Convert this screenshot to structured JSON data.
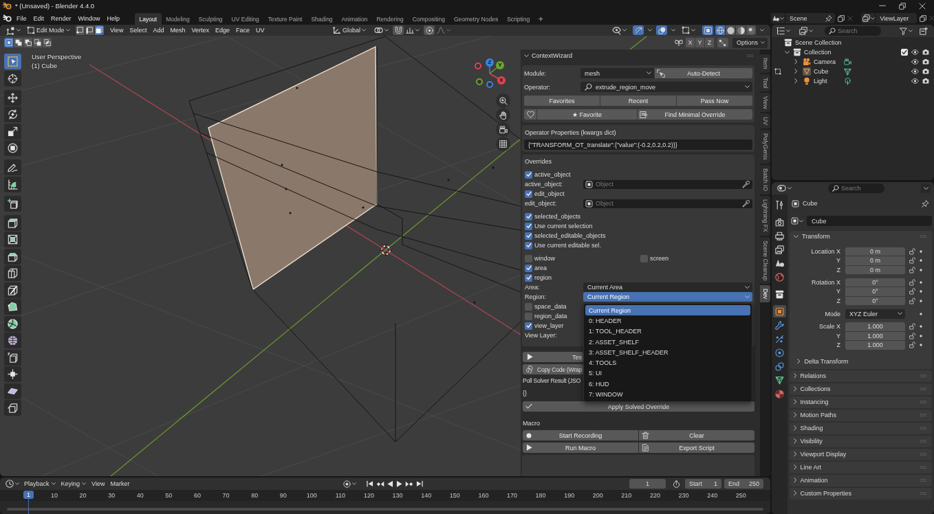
{
  "title_bar": {
    "title": "* (Unsaved) - Blender 4.4.0"
  },
  "top_bar": {
    "menus": [
      "File",
      "Edit",
      "Render",
      "Window",
      "Help"
    ],
    "workspaces": [
      {
        "label": "Layout",
        "selected": true
      },
      {
        "label": "Modeling",
        "selected": false
      },
      {
        "label": "Sculpting",
        "selected": false
      },
      {
        "label": "UV Editing",
        "selected": false
      },
      {
        "label": "Texture Paint",
        "selected": false
      },
      {
        "label": "Shading",
        "selected": false
      },
      {
        "label": "Animation",
        "selected": false
      },
      {
        "label": "Rendering",
        "selected": false
      },
      {
        "label": "Compositing",
        "selected": false
      },
      {
        "label": "Geometry Nodes",
        "selected": false
      },
      {
        "label": "Scripting",
        "selected": false
      }
    ],
    "add_workspace": "+",
    "scene": "Scene",
    "view_layer": "ViewLayer"
  },
  "viewport": {
    "header": {
      "mode": "Edit Mode",
      "select_modes": [
        {
          "kind": "vertex",
          "selected": false
        },
        {
          "kind": "edge",
          "selected": false
        },
        {
          "kind": "face",
          "selected": true
        }
      ],
      "menus": [
        "View",
        "Select",
        "Add",
        "Mesh",
        "Vertex",
        "Edge",
        "Face",
        "UV"
      ],
      "orientation": "Global",
      "snapping": {
        "on": false
      },
      "proportional_editing": {
        "on": false
      },
      "gizmos": {
        "on": true
      },
      "overlays": {
        "on": true
      },
      "xray": {
        "on": true
      },
      "shading": [
        {
          "kind": "wireframe",
          "selected": true
        },
        {
          "kind": "solid",
          "selected": false
        },
        {
          "kind": "material",
          "selected": false
        },
        {
          "kind": "rendered",
          "selected": false
        }
      ]
    },
    "tool_settings": {
      "select_box_modes": [
        {
          "kind": "set",
          "selected": true
        },
        {
          "kind": "extend",
          "selected": false
        },
        {
          "kind": "subtract",
          "selected": false
        },
        {
          "kind": "invert",
          "selected": false
        },
        {
          "kind": "intersect",
          "selected": false
        }
      ],
      "mirror_axes": [
        {
          "label": "X",
          "selected": false
        },
        {
          "label": "Y",
          "selected": false
        },
        {
          "label": "Z",
          "selected": false
        }
      ],
      "options": "Options"
    },
    "view_name": "User Perspective",
    "object_label": "(1) Cube",
    "gizmo_axes": [
      {
        "label": "Z",
        "color": "#3b82e0"
      },
      {
        "label": "Y",
        "color": "#6aa52c"
      },
      {
        "label": "X",
        "color": "#e0434f"
      }
    ],
    "tool_groups": [
      [
        {
          "kind": "select_box",
          "selected": true
        },
        {
          "kind": "cursor",
          "selected": false
        }
      ],
      [
        {
          "kind": "move",
          "selected": false
        },
        {
          "kind": "rotate",
          "selected": false
        },
        {
          "kind": "scale",
          "selected": false
        },
        {
          "kind": "transform",
          "selected": false
        }
      ],
      [
        {
          "kind": "annotate",
          "selected": false
        },
        {
          "kind": "measure",
          "selected": false
        }
      ],
      [
        {
          "kind": "add_cube",
          "selected": false
        }
      ],
      [
        {
          "kind": "extrude",
          "selected": false
        },
        {
          "kind": "inset",
          "selected": false
        },
        {
          "kind": "bevel",
          "selected": false
        },
        {
          "kind": "loop_cut",
          "selected": false
        },
        {
          "kind": "knife",
          "selected": false
        },
        {
          "kind": "poly_build",
          "selected": false
        },
        {
          "kind": "spin",
          "selected": false
        },
        {
          "kind": "smooth",
          "selected": false
        },
        {
          "kind": "edge_slide",
          "selected": false
        },
        {
          "kind": "shrink_fatten",
          "selected": false
        },
        {
          "kind": "shear",
          "selected": false
        },
        {
          "kind": "rip",
          "selected": false
        }
      ]
    ]
  },
  "sidebar": {
    "tabs": [
      {
        "label": "Item",
        "selected": false
      },
      {
        "label": "Tool",
        "selected": false
      },
      {
        "label": "View",
        "selected": false
      },
      {
        "label": "UV",
        "selected": false
      },
      {
        "label": "PolyGenix",
        "selected": false
      },
      {
        "label": "Batch IO",
        "selected": false
      },
      {
        "label": "Lightning FX",
        "selected": false
      },
      {
        "label": "Scene Cleanup",
        "selected": false
      },
      {
        "label": "Dev",
        "selected": true
      }
    ],
    "panel": {
      "title": "ContextWizard",
      "expanded": true
    },
    "module": {
      "label": "Module:",
      "value": "mesh"
    },
    "auto_detect": "Auto-Detect",
    "operator": {
      "label": "Operator:",
      "value": "extrude_region_move"
    },
    "list_buttons": [
      "Favorites",
      "Recent",
      "Pass Now"
    ],
    "favorite_button": "★ Favorite",
    "find_override_button": "Find Minimal Override",
    "operator_properties": {
      "title": "Operator Properties (kwargs dict)",
      "value": "{\"TRANSFORM_OT_translate\":{\"value\":(-0.2,0.2,0.2)}}"
    },
    "overrides": {
      "title": "Overrides",
      "groups": [
        [
          {
            "kind": "checkbox",
            "label": "active_object",
            "checked": true
          },
          {
            "kind": "object_field",
            "label": "active_object:",
            "placeholder": "Object"
          },
          {
            "kind": "checkbox",
            "label": "edit_object",
            "checked": true
          },
          {
            "kind": "object_field",
            "label": "edit_object:",
            "placeholder": "Object"
          }
        ],
        [
          {
            "kind": "checkbox",
            "label": "selected_objects",
            "checked": true
          },
          {
            "kind": "checkbox",
            "label": "Use current selection",
            "checked": true
          },
          {
            "kind": "checkbox",
            "label": "selected_editable_objects",
            "checked": true
          },
          {
            "kind": "checkbox",
            "label": "Use current editable sel.",
            "checked": true
          }
        ],
        [
          {
            "kind": "checkbox_pair",
            "items": [
              {
                "label": "window",
                "checked": false
              },
              {
                "label": "screen",
                "checked": false
              }
            ]
          },
          {
            "kind": "checkbox",
            "label": "area",
            "checked": true
          },
          {
            "kind": "checkbox",
            "label": "region",
            "checked": true
          },
          {
            "kind": "dropdown",
            "label": "Area:",
            "value": "Current Area",
            "open": false
          },
          {
            "kind": "dropdown",
            "label": "Region:",
            "value": "Current Region",
            "open": true
          },
          {
            "kind": "checkbox",
            "label": "space_data",
            "checked": false
          },
          {
            "kind": "checkbox",
            "label": "region_data",
            "checked": false
          },
          {
            "kind": "checkbox",
            "label": "view_layer",
            "checked": true
          },
          {
            "kind": "label",
            "label": "View Layer:"
          }
        ]
      ]
    },
    "test_button": "Tes",
    "copy_code_button": "Copy Code (Wrap",
    "poll_result": {
      "label": "Poll Solver Result (JSO",
      "value": "{}"
    },
    "apply_button": "Apply Solved Override",
    "macro": {
      "title": "Macro",
      "start_recording": "Start Recording",
      "clear": "Clear",
      "run_macro": "Run Macro",
      "export_script": "Export Script"
    },
    "region_menu": {
      "items": [
        {
          "label": "Current Region",
          "selected": true
        },
        {
          "label": "0: HEADER",
          "selected": false
        },
        {
          "label": "1: TOOL_HEADER",
          "selected": false
        },
        {
          "label": "2: ASSET_SHELF",
          "selected": false
        },
        {
          "label": "3: ASSET_SHELF_HEADER",
          "selected": false
        },
        {
          "label": "4: TOOLS",
          "selected": false
        },
        {
          "label": "5: UI",
          "selected": false
        },
        {
          "label": "6: HUD",
          "selected": false
        },
        {
          "label": "7: WINDOW",
          "selected": false
        }
      ]
    }
  },
  "outliner": {
    "search_placeholder": "Search",
    "tree": [
      {
        "label": "Scene Collection",
        "kind": "scene_collection",
        "children": [
          {
            "label": "Collection",
            "kind": "collection",
            "expanded": true,
            "checked": true,
            "children": [
              {
                "label": "Camera",
                "kind": "camera",
                "expanded": false,
                "active": false
              },
              {
                "label": "Cube",
                "kind": "mesh",
                "expanded": false,
                "active": true
              },
              {
                "label": "Light",
                "kind": "light",
                "expanded": false,
                "active": false
              }
            ]
          }
        ]
      }
    ]
  },
  "properties": {
    "search_placeholder": "Search",
    "tab_groups": [
      [
        {
          "kind": "tool",
          "selected": false
        }
      ],
      [
        {
          "kind": "render",
          "selected": false
        },
        {
          "kind": "output",
          "selected": false
        },
        {
          "kind": "view_layer",
          "selected": false
        },
        {
          "kind": "scene",
          "selected": false
        },
        {
          "kind": "world",
          "selected": false
        }
      ],
      [
        {
          "kind": "collection",
          "selected": false
        }
      ],
      [
        {
          "kind": "object",
          "selected": true
        },
        {
          "kind": "modifiers",
          "selected": false
        },
        {
          "kind": "particles",
          "selected": false
        },
        {
          "kind": "physics",
          "selected": false
        },
        {
          "kind": "constraints",
          "selected": false
        },
        {
          "kind": "data",
          "selected": false
        },
        {
          "kind": "material",
          "selected": false
        }
      ]
    ],
    "context": "Cube",
    "object_name": "Cube",
    "transform": {
      "title": "Transform",
      "expanded": true,
      "groups": [
        {
          "kind": "vector",
          "rows": [
            {
              "label": "Location X",
              "value": "0 m"
            },
            {
              "label": "Y",
              "value": "0 m"
            },
            {
              "label": "Z",
              "value": "0 m"
            }
          ]
        },
        {
          "kind": "vector",
          "rows": [
            {
              "label": "Rotation X",
              "value": "0°"
            },
            {
              "label": "Y",
              "value": "0°"
            },
            {
              "label": "Z",
              "value": "0°"
            }
          ]
        },
        {
          "kind": "enum",
          "label": "Mode",
          "value": "XYZ Euler"
        },
        {
          "kind": "vector",
          "rows": [
            {
              "label": "Scale X",
              "value": "1.000"
            },
            {
              "label": "Y",
              "value": "1.000"
            },
            {
              "label": "Z",
              "value": "1.000"
            }
          ]
        }
      ],
      "subpanels": [
        {
          "title": "Delta Transform",
          "expanded": false
        }
      ]
    },
    "panels": [
      {
        "title": "Relations",
        "expanded": false
      },
      {
        "title": "Collections",
        "expanded": false
      },
      {
        "title": "Instancing",
        "expanded": false
      },
      {
        "title": "Motion Paths",
        "expanded": false
      },
      {
        "title": "Shading",
        "expanded": false
      },
      {
        "title": "Visibility",
        "expanded": false
      },
      {
        "title": "Viewport Display",
        "expanded": false
      },
      {
        "title": "Line Art",
        "expanded": false
      },
      {
        "title": "Animation",
        "expanded": false
      },
      {
        "title": "Custom Properties",
        "expanded": false
      }
    ]
  },
  "timeline": {
    "menus": [
      {
        "label": "Playback",
        "dropdown": true
      },
      {
        "label": "Keying",
        "dropdown": true
      },
      {
        "label": "View",
        "dropdown": false
      },
      {
        "label": "Marker",
        "dropdown": false
      }
    ],
    "current_frame": "1",
    "start": {
      "label": "Start",
      "value": "1"
    },
    "end": {
      "label": "End",
      "value": "250"
    },
    "playhead": "1",
    "ruler_labels": [
      "10",
      "20",
      "30",
      "40",
      "50",
      "60",
      "70",
      "80",
      "90",
      "100",
      "110",
      "120",
      "130",
      "140",
      "150",
      "160",
      "170",
      "180",
      "190",
      "200",
      "210",
      "220",
      "230",
      "240",
      "250"
    ]
  }
}
